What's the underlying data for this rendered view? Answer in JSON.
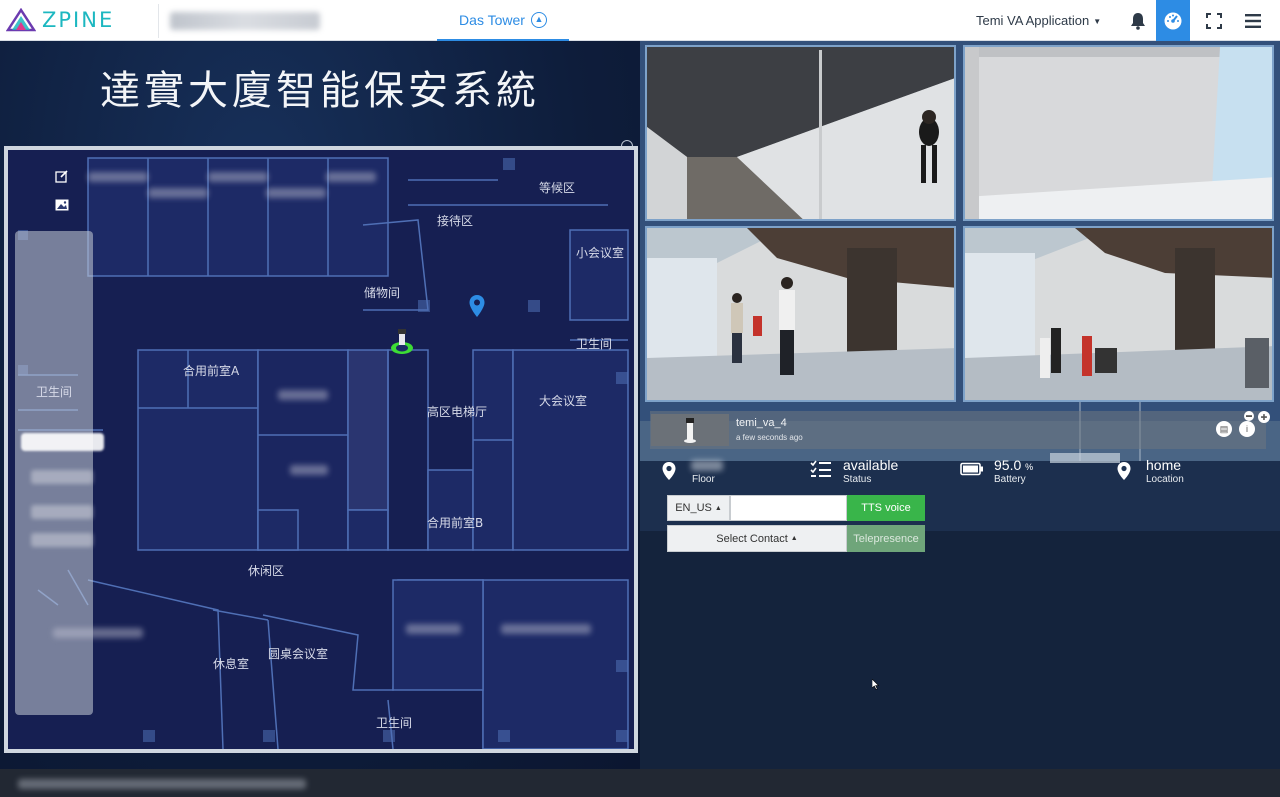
{
  "header": {
    "logo_text": "ZPINE",
    "active_tab": "Das Tower",
    "app_selector": "Temi VA Application"
  },
  "title": "達實大廈智能保安系統",
  "map": {
    "labels": {
      "waiting_area": "等候区",
      "reception": "接待区",
      "small_meeting": "小会议室",
      "storage": "储物间",
      "restroom_right": "卫生间",
      "restroom_left": "卫生间",
      "meeting_room_a": "合用前室A",
      "elevator_hall": "高区电梯厅",
      "large_meeting": "大会议室",
      "meeting_room_b": "合用前室B",
      "lounge": "休闲区",
      "rest_room": "休息室",
      "round_table": "圆桌会议室",
      "restroom_bottom": "卫生间"
    }
  },
  "robot": {
    "name": "temi_va_4",
    "last_seen": "a few seconds ago",
    "status_value": "available",
    "status_label": "Status",
    "battery_value": "95.0",
    "battery_unit": "%",
    "battery_label": "Battery",
    "location_value": "home",
    "location_label": "Location",
    "floor_label": "Floor"
  },
  "controls": {
    "language": "EN_US",
    "tts_input_value": "",
    "tts_button": "TTS voice",
    "contact_button": "Select Contact",
    "telepresence_button": "Telepresence"
  },
  "colors": {
    "accent": "#2d8ce4",
    "logo": "#1cb7c0",
    "tts_green": "#39b54a",
    "map_bg": "#161f52"
  }
}
